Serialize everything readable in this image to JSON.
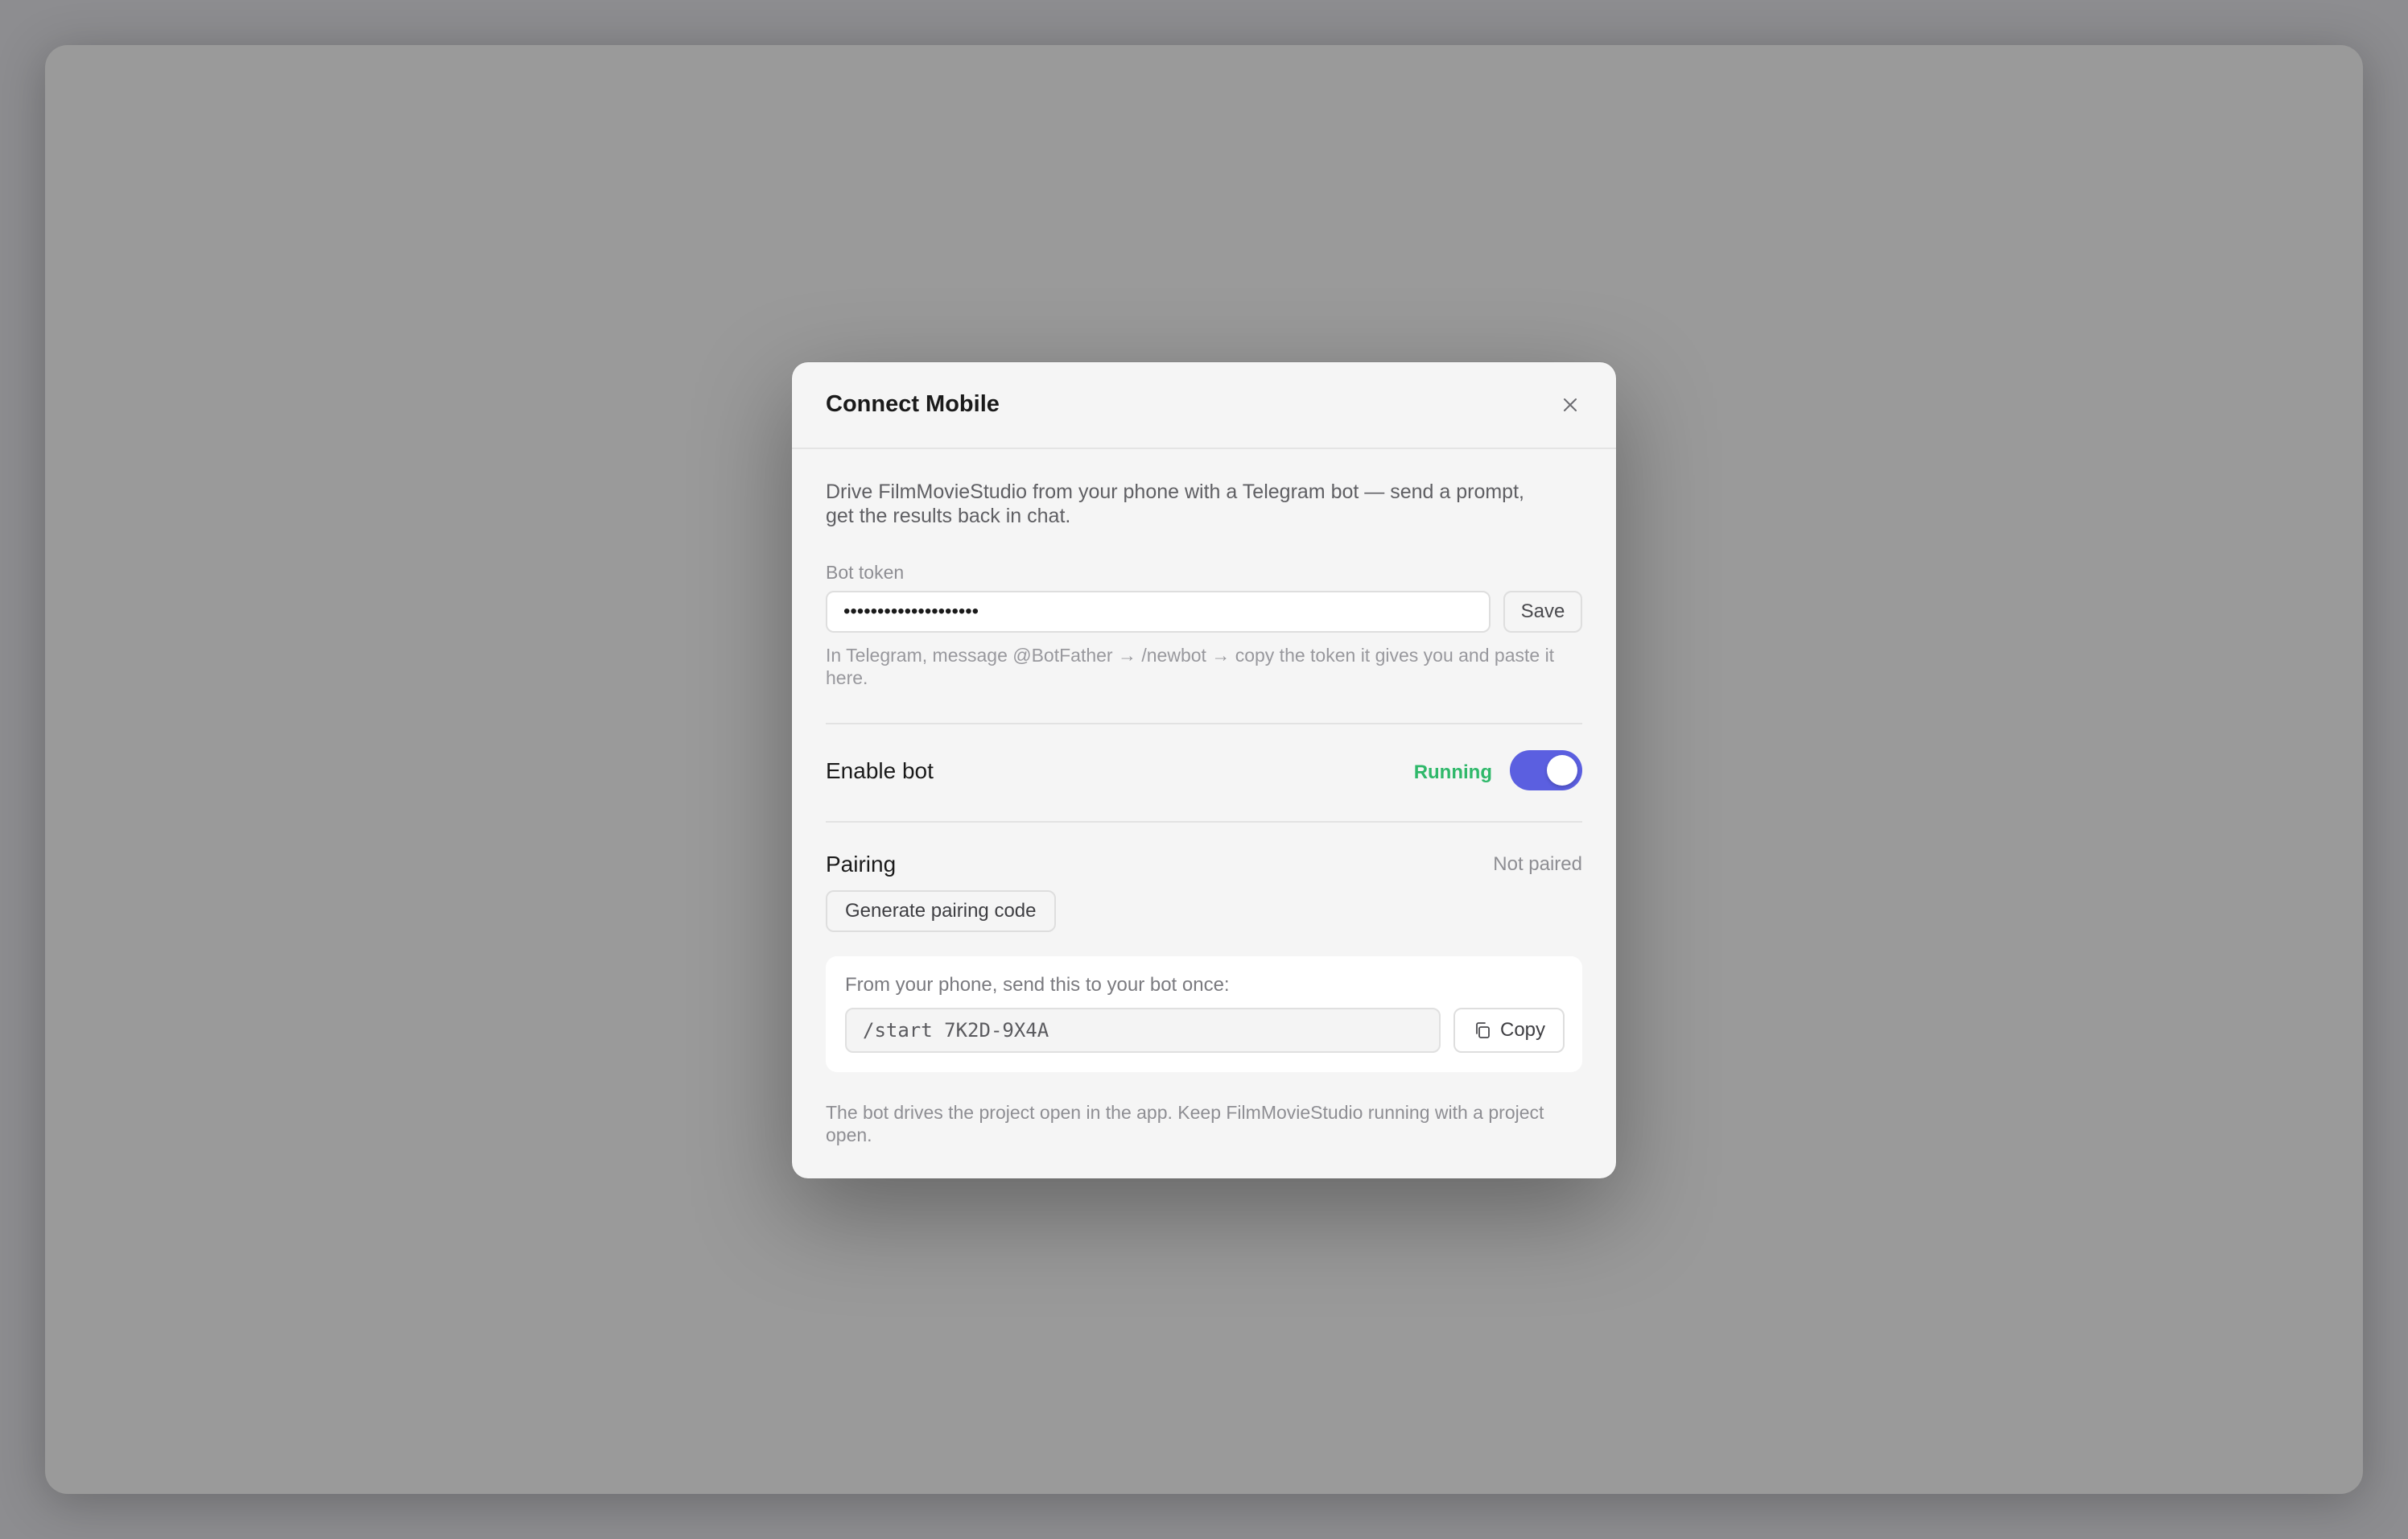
{
  "dialog": {
    "title": "Connect Mobile",
    "close_icon": "close-icon",
    "intro": "Drive FilmMovieStudio from your phone with a Telegram bot — send a prompt, get the results back in chat."
  },
  "bot_token": {
    "label": "Bot token",
    "value": "••••••••••••••••••••",
    "save_label": "Save",
    "help": "In Telegram, message @BotFather → /newbot → copy the token it gives you and paste it here."
  },
  "enable_bot": {
    "label": "Enable bot",
    "status": "Running",
    "status_color": "#2fb86a",
    "toggle_on": true,
    "toggle_color": "#5b5fe0"
  },
  "pairing": {
    "label": "Pairing",
    "status": "Not paired",
    "generate_label": "Generate pairing code",
    "instruction": "From your phone, send this to your bot once:",
    "code": "/start 7K2D-9X4A",
    "copy_label": "Copy",
    "copy_icon": "copy-icon"
  },
  "footer": {
    "note": "The bot drives the project open in the app. Keep FilmMovieStudio running with a project open."
  }
}
